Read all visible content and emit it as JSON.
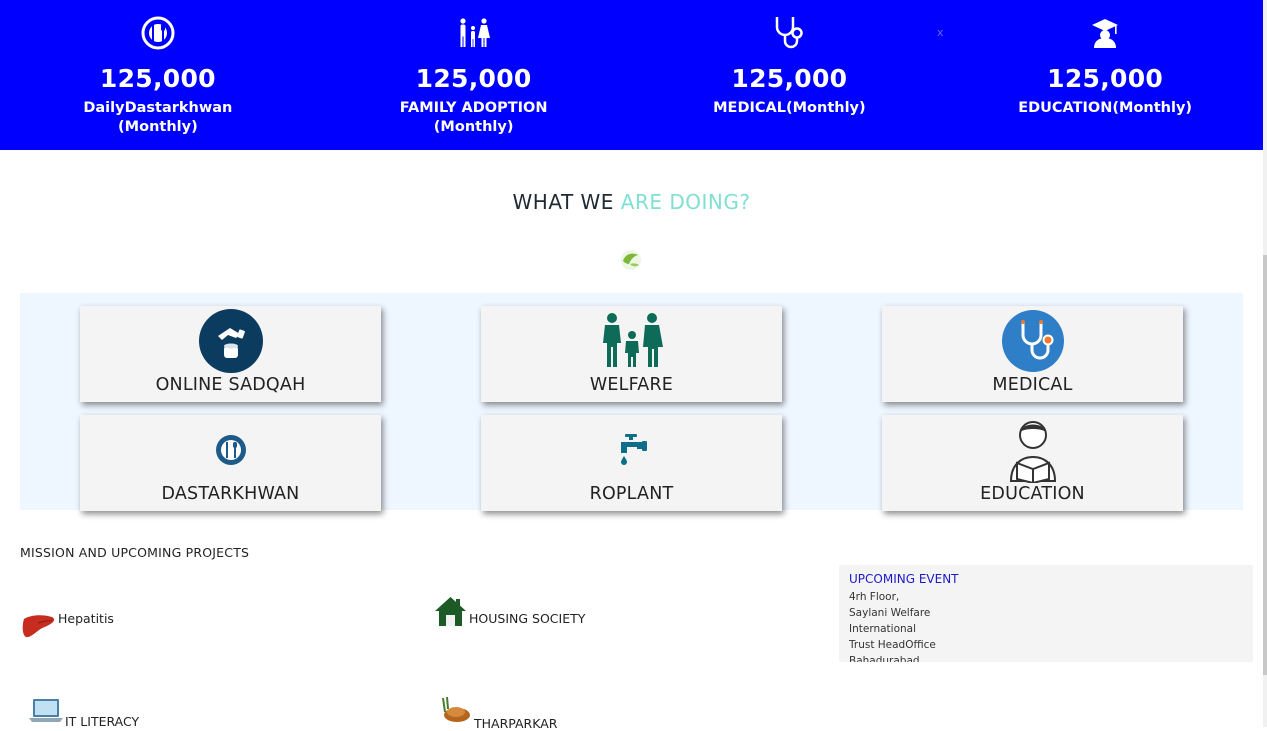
{
  "stats": [
    {
      "icon": "plate-cutlery-icon",
      "value": "125,000",
      "label_line1": "DailyDastarkhwan",
      "label_line2": "(Monthly)"
    },
    {
      "icon": "family-icon",
      "value": "125,000",
      "label_line1": "FAMILY ADOPTION",
      "label_line2": "(Monthly)"
    },
    {
      "icon": "stethoscope-icon",
      "value": "125,000",
      "label_line1": "MEDICAL(Monthly)",
      "label_line2": ""
    },
    {
      "icon": "graduate-icon",
      "value": "125,000",
      "label_line1": "EDUCATION(Monthly)",
      "label_line2": ""
    }
  ],
  "close_glyph": "x",
  "heading": {
    "part1": "WHAT WE ",
    "part2": "ARE DOING?"
  },
  "services": [
    {
      "label": "ONLINE SADQAH",
      "icon": "donation-icon"
    },
    {
      "label": "WELFARE",
      "icon": "family-icon"
    },
    {
      "label": "MEDICAL",
      "icon": "stethoscope-icon"
    },
    {
      "label": "DASTARKHWAN",
      "icon": "plate-cutlery-icon"
    },
    {
      "label": "ROPLANT",
      "icon": "water-tap-icon"
    },
    {
      "label": "EDUCATION",
      "icon": "student-reading-icon"
    }
  ],
  "mission": {
    "title": "MISSION AND UPCOMING PROJECTS",
    "projects": [
      {
        "label": "Hepatitis",
        "icon": "liver-icon"
      },
      {
        "label": "HOUSING SOCIETY",
        "icon": "house-icon"
      },
      {
        "label": "IT LITERACY",
        "icon": "laptop-icon"
      },
      {
        "label": "THARPARKAR",
        "icon": "tharparkar-icon"
      }
    ]
  },
  "event": {
    "title": "UPCOMING EVENT",
    "lines": [
      "4rh Floor,",
      "Saylani Welfare",
      "International",
      "Trust HeadOffice",
      "Bahadurabad"
    ]
  },
  "colors": {
    "banner": "#0000ff",
    "accent": "#7fe0d2",
    "event_title": "#1a1acc",
    "services_bg": "#eef6ff"
  }
}
